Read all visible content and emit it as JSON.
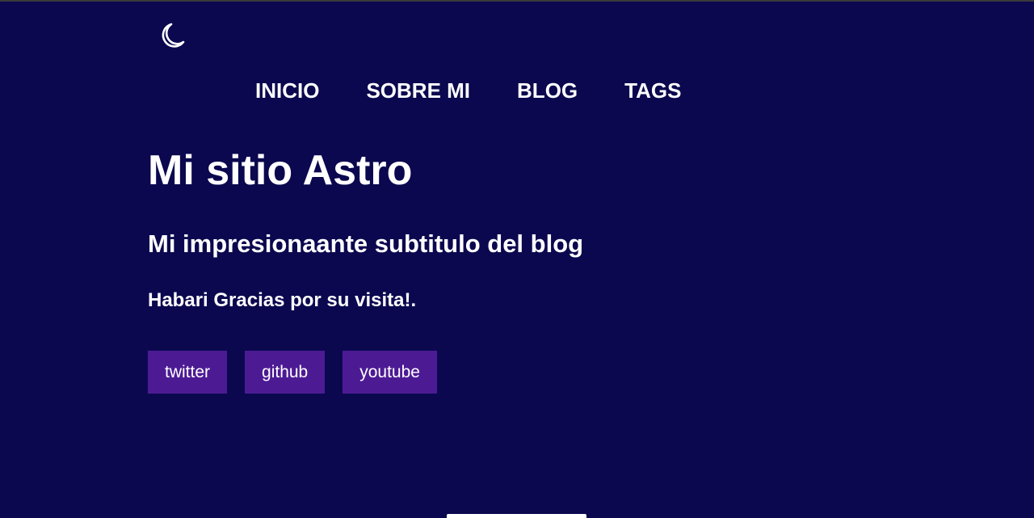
{
  "header": {
    "theme_toggle_icon": "moon-icon",
    "nav": [
      {
        "label": "INICIO"
      },
      {
        "label": "SOBRE MI"
      },
      {
        "label": "BLOG"
      },
      {
        "label": "TAGS"
      }
    ]
  },
  "main": {
    "title": "Mi sitio Astro",
    "subtitle": "Mi impresionaante subtitulo del blog",
    "welcome": "Habari Gracias por su visita!."
  },
  "social": [
    {
      "label": "twitter"
    },
    {
      "label": "github"
    },
    {
      "label": "youtube"
    }
  ],
  "colors": {
    "background": "#0b084f",
    "button": "#4c1b94",
    "text": "#ffffff"
  }
}
